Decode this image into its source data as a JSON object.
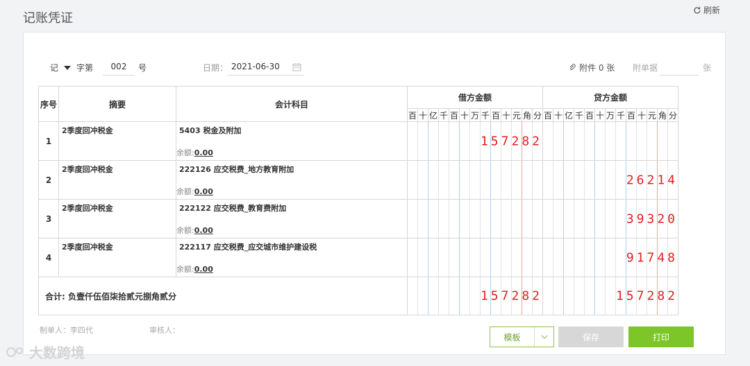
{
  "page": {
    "title": "记账凭证",
    "refresh_label": "刷新"
  },
  "header": {
    "voucher_type": "记",
    "zi_label": "字第",
    "voucher_number": "002",
    "hao_label": "号",
    "date_label": "日期：",
    "date_value": "2021-06-30",
    "attachment_label": "附件 0 张",
    "doc_label": "附单据",
    "doc_value": "",
    "zhang_label": "张"
  },
  "table": {
    "headers": {
      "seq": "序号",
      "summary": "摘要",
      "account": "会计科目",
      "debit": "借方金额",
      "credit": "贷方金额"
    },
    "digit_units": [
      "百",
      "十",
      "亿",
      "千",
      "百",
      "十",
      "万",
      "千",
      "百",
      "十",
      "元",
      "角",
      "分"
    ],
    "balance_label": "余额:",
    "rows": [
      {
        "seq": "1",
        "summary": "2季度回冲税金",
        "account": "5403 税金及附加",
        "balance": "0.00",
        "debit": "157282",
        "credit": ""
      },
      {
        "seq": "2",
        "summary": "2季度回冲税金",
        "account": "222126 应交税费_地方教育附加",
        "balance": "0.00",
        "debit": "",
        "credit": "26214"
      },
      {
        "seq": "3",
        "summary": "2季度回冲税金",
        "account": "222122 应交税费_教育费附加",
        "balance": "0.00",
        "debit": "",
        "credit": "39320"
      },
      {
        "seq": "4",
        "summary": "2季度回冲税金",
        "account": "222117 应交税费_应交城市维护建设税",
        "balance": "0.00",
        "debit": "",
        "credit": "91748"
      }
    ],
    "total": {
      "label": "合计:  负壹仟伍佰柒拾贰元捌角贰分",
      "debit": "157282",
      "credit": "157282"
    }
  },
  "footer": {
    "maker_label": "制单人：李四代",
    "reviewer_label": "审核人：",
    "template_button": "模板",
    "save_button": "保存",
    "print_button": "打印"
  },
  "watermark": "大数跨境",
  "colors": {
    "accent": "#7cc629",
    "amount_red": "#e02020",
    "disabled": "#d7d7d7"
  }
}
